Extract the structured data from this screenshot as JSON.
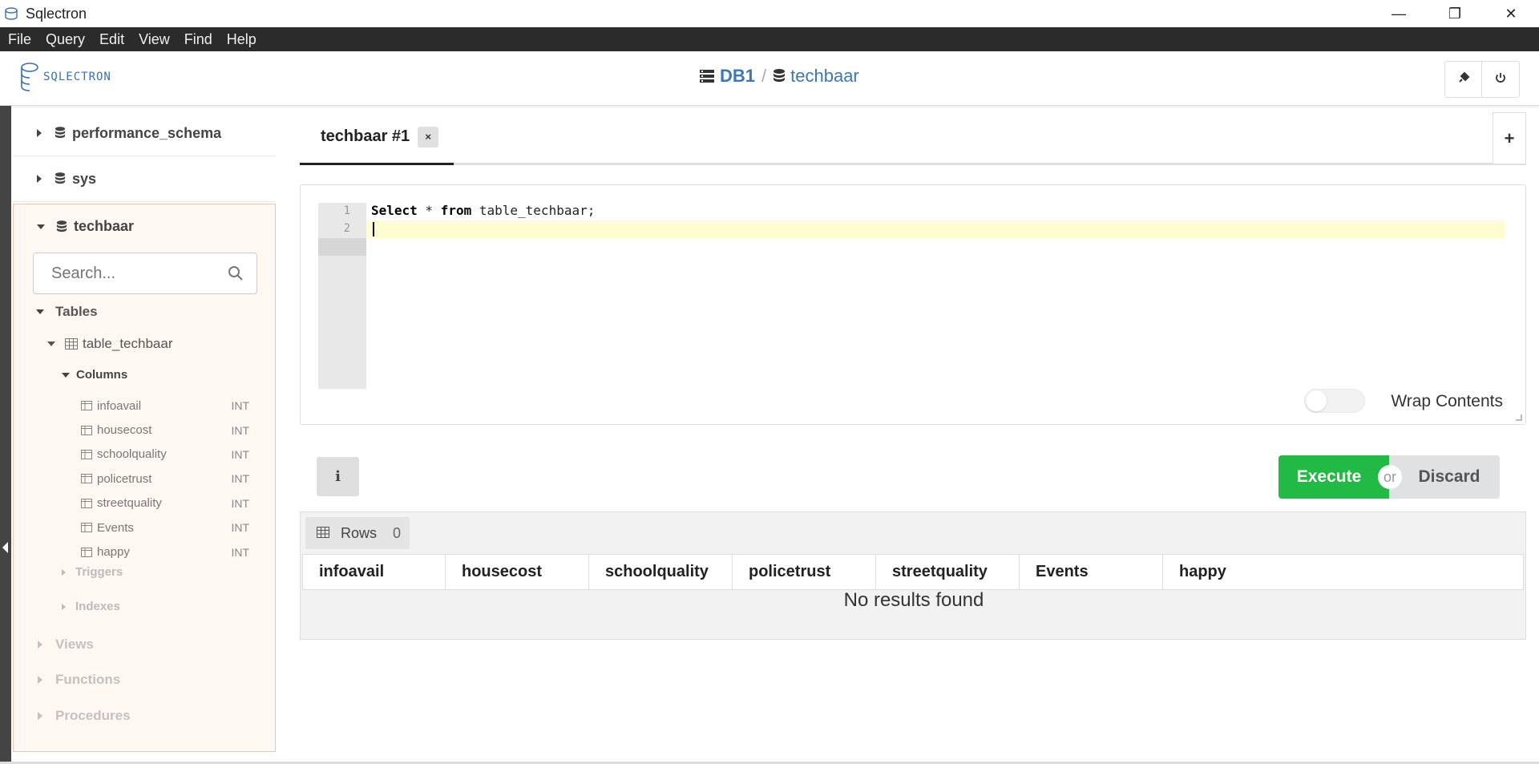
{
  "window": {
    "title": "Sqlectron",
    "minimize": "—",
    "restore": "❐",
    "close": "✕"
  },
  "menu": [
    "File",
    "Query",
    "Edit",
    "View",
    "Find",
    "Help"
  ],
  "header": {
    "logo_text": "SQLECTRON",
    "breadcrumb_db": "DB1",
    "breadcrumb_sep": "/",
    "breadcrumb_schema": "techbaar"
  },
  "sidebar": {
    "databases": [
      "performance_schema",
      "sys"
    ],
    "open_db": "techbaar",
    "search_placeholder": "Search...",
    "tables_label": "Tables",
    "table_name": "table_techbaar",
    "columns_label": "Columns",
    "columns": [
      {
        "name": "infoavail",
        "type": "INT"
      },
      {
        "name": "housecost",
        "type": "INT"
      },
      {
        "name": "schoolquality",
        "type": "INT"
      },
      {
        "name": "policetrust",
        "type": "INT"
      },
      {
        "name": "streetquality",
        "type": "INT"
      },
      {
        "name": "Events",
        "type": "INT"
      },
      {
        "name": "happy",
        "type": "INT"
      }
    ],
    "triggers_label": "Triggers",
    "indexes_label": "Indexes",
    "views_label": "Views",
    "functions_label": "Functions",
    "procedures_label": "Procedures"
  },
  "tabs": {
    "active_label": "techbaar #1",
    "close_label": "×",
    "add_label": "+"
  },
  "editor": {
    "line_numbers": [
      "1",
      "2"
    ],
    "line1_kw1": "Select",
    "line1_mid": " * ",
    "line1_kw2": "from",
    "line1_rest": " table_techbaar;",
    "wrap_label": "Wrap Contents"
  },
  "actions": {
    "info_label": "i",
    "execute_label": "Execute",
    "or_label": "or",
    "discard_label": "Discard"
  },
  "results": {
    "rows_label": "Rows",
    "rows_count": "0",
    "headers": [
      "infoavail",
      "housecost",
      "schoolquality",
      "policetrust",
      "streetquality",
      "Events",
      "happy"
    ],
    "empty_message": "No results found"
  },
  "colors": {
    "execute": "#21ba45",
    "accent": "#3b78b5",
    "menubar": "#2b2b2b",
    "sidebar_active_bg": "#fff8f2"
  }
}
